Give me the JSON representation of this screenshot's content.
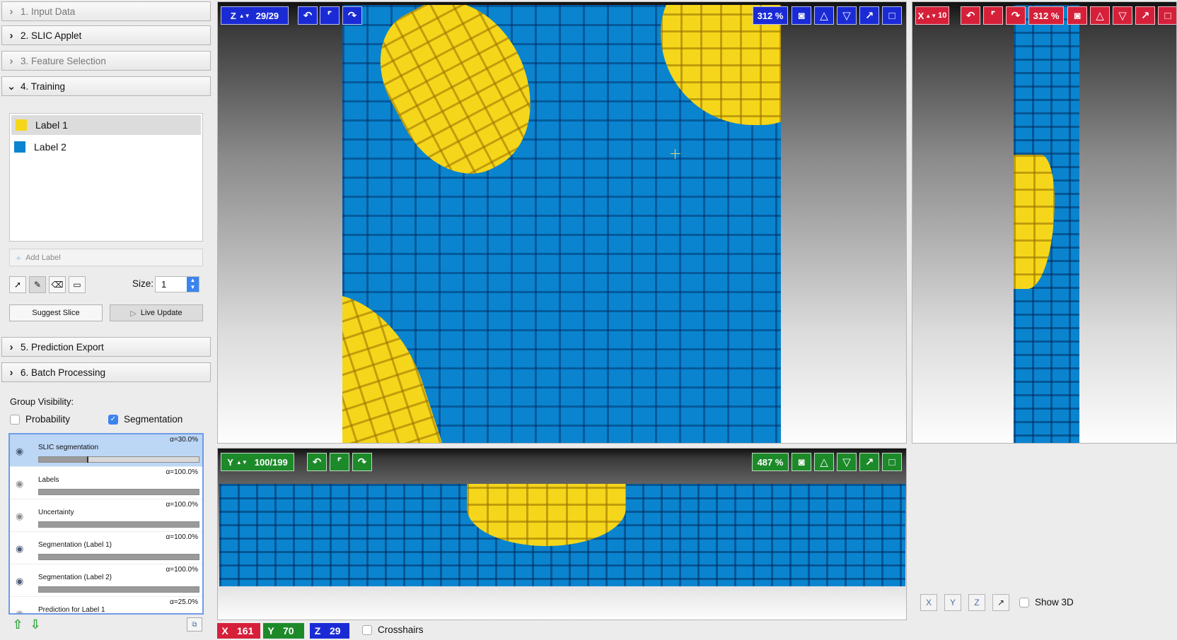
{
  "applets": [
    {
      "label": "1. Input Data",
      "state": "collapsed",
      "enabled": false
    },
    {
      "label": "2. SLIC Applet",
      "state": "collapsed",
      "enabled": true
    },
    {
      "label": "3. Feature Selection",
      "state": "collapsed",
      "enabled": false
    },
    {
      "label": "4. Training",
      "state": "expanded",
      "enabled": true
    },
    {
      "label": "5. Prediction Export",
      "state": "collapsed",
      "enabled": true
    },
    {
      "label": "6. Batch Processing",
      "state": "collapsed",
      "enabled": true
    }
  ],
  "training": {
    "labels": [
      {
        "name": "Label 1",
        "color": "#f5d61a",
        "selected": true
      },
      {
        "name": "Label 2",
        "color": "#0a84cf",
        "selected": false
      }
    ],
    "add_label": "Add Label",
    "size_label": "Size:",
    "size_value": "1",
    "suggest_slice": "Suggest Slice",
    "live_update": "Live Update"
  },
  "group_visibility": {
    "title": "Group Visibility:",
    "probability": {
      "label": "Probability",
      "checked": false
    },
    "segmentation": {
      "label": "Segmentation",
      "checked": true
    }
  },
  "layers": [
    {
      "name": "SLIC segmentation",
      "alpha": "α=30.0%",
      "opacity": 0.3,
      "visible": true,
      "selected": true
    },
    {
      "name": "Labels",
      "alpha": "α=100.0%",
      "opacity": 1.0,
      "visible": false,
      "selected": false
    },
    {
      "name": "Uncertainty",
      "alpha": "α=100.0%",
      "opacity": 1.0,
      "visible": false,
      "selected": false
    },
    {
      "name": "Segmentation (Label 1)",
      "alpha": "α=100.0%",
      "opacity": 1.0,
      "visible": true,
      "selected": false
    },
    {
      "name": "Segmentation (Label 2)",
      "alpha": "α=100.0%",
      "opacity": 1.0,
      "visible": true,
      "selected": false
    },
    {
      "name": "Prediction for Label 1",
      "alpha": "α=25.0%",
      "opacity": 0.25,
      "visible": false,
      "selected": false
    }
  ],
  "viewers": {
    "z": {
      "axis": "Z",
      "slice": "29/29",
      "zoom": "312 %",
      "color": "#1a2bd6"
    },
    "x": {
      "axis": "X",
      "slice": "10",
      "zoom": "312 %",
      "color": "#d6203a"
    },
    "y": {
      "axis": "Y",
      "slice": "100/199",
      "zoom": "487 %",
      "color": "#1d8a2a"
    }
  },
  "coordinates": {
    "x_label": "X",
    "x": "161",
    "y_label": "Y",
    "y": "70",
    "z_label": "Z",
    "z": "29",
    "crosshairs": "Crosshairs"
  },
  "view3d": {
    "show_3d": "Show 3D",
    "checked": false
  },
  "icons": [
    "chevron-right-icon",
    "chevron-down-icon",
    "eye-icon",
    "camera-icon",
    "undo-icon",
    "redo-icon",
    "maximize-icon"
  ]
}
